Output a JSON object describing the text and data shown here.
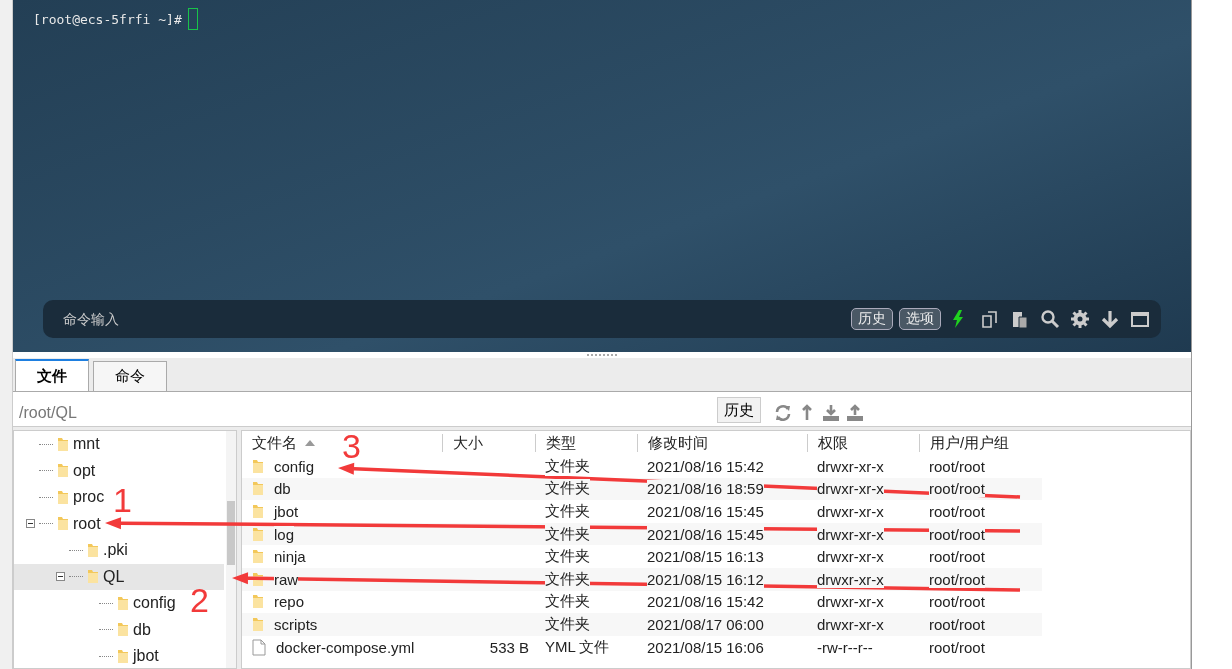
{
  "terminal": {
    "prompt": "[root@ecs-5frfi ~]#",
    "command_input": {
      "placeholder": "命令输入"
    },
    "buttons": [
      "历史",
      "选项"
    ]
  },
  "tabs": [
    {
      "label": "文件",
      "selected": true
    },
    {
      "label": "命令",
      "selected": false
    }
  ],
  "path_bar": {
    "value": "/root/QL",
    "history_button": "历史"
  },
  "tree": [
    {
      "name": "mnt"
    },
    {
      "name": "opt"
    },
    {
      "name": "proc"
    },
    {
      "name": "root",
      "expanded": true,
      "selected": false,
      "children": [
        {
          "name": ".pki"
        },
        {
          "name": "QL",
          "expanded": true,
          "selected": true,
          "children": [
            {
              "name": "config"
            },
            {
              "name": "db"
            },
            {
              "name": "jbot"
            }
          ]
        }
      ]
    }
  ],
  "table": {
    "columns": [
      {
        "label": "文件名",
        "sorted": true
      },
      {
        "label": "大小",
        "sorted": false
      },
      {
        "label": "类型",
        "sorted": false
      },
      {
        "label": "修改时间",
        "sorted": false
      },
      {
        "label": "权限",
        "sorted": false
      },
      {
        "label": "用户/用户组",
        "sorted": false
      }
    ],
    "rows": [
      {
        "kind": "folder",
        "name": "config",
        "size": "",
        "type": "文件夹",
        "modified": "2021/08/16 15:42",
        "permissions": "drwxr-xr-x",
        "owner": "root/root"
      },
      {
        "kind": "folder",
        "name": "db",
        "size": "",
        "type": "文件夹",
        "modified": "2021/08/16 18:59",
        "permissions": "drwxr-xr-x",
        "owner": "root/root"
      },
      {
        "kind": "folder",
        "name": "jbot",
        "size": "",
        "type": "文件夹",
        "modified": "2021/08/16 15:45",
        "permissions": "drwxr-xr-x",
        "owner": "root/root"
      },
      {
        "kind": "folder",
        "name": "log",
        "size": "",
        "type": "文件夹",
        "modified": "2021/08/16 15:45",
        "permissions": "drwxr-xr-x",
        "owner": "root/root"
      },
      {
        "kind": "folder",
        "name": "ninja",
        "size": "",
        "type": "文件夹",
        "modified": "2021/08/15 16:13",
        "permissions": "drwxr-xr-x",
        "owner": "root/root"
      },
      {
        "kind": "folder",
        "name": "raw",
        "size": "",
        "type": "文件夹",
        "modified": "2021/08/15 16:12",
        "permissions": "drwxr-xr-x",
        "owner": "root/root"
      },
      {
        "kind": "folder",
        "name": "repo",
        "size": "",
        "type": "文件夹",
        "modified": "2021/08/16 15:42",
        "permissions": "drwxr-xr-x",
        "owner": "root/root"
      },
      {
        "kind": "folder",
        "name": "scripts",
        "size": "",
        "type": "文件夹",
        "modified": "2021/08/17 06:00",
        "permissions": "drwxr-xr-x",
        "owner": "root/root"
      },
      {
        "kind": "file",
        "name": "docker-compose.yml",
        "size": "533 B",
        "type": "YML 文件",
        "modified": "2021/08/15 16:06",
        "permissions": "-rw-r--r--",
        "owner": "root/root"
      }
    ]
  },
  "annotations": [
    {
      "label": "1"
    },
    {
      "label": "2"
    },
    {
      "label": "3"
    }
  ]
}
